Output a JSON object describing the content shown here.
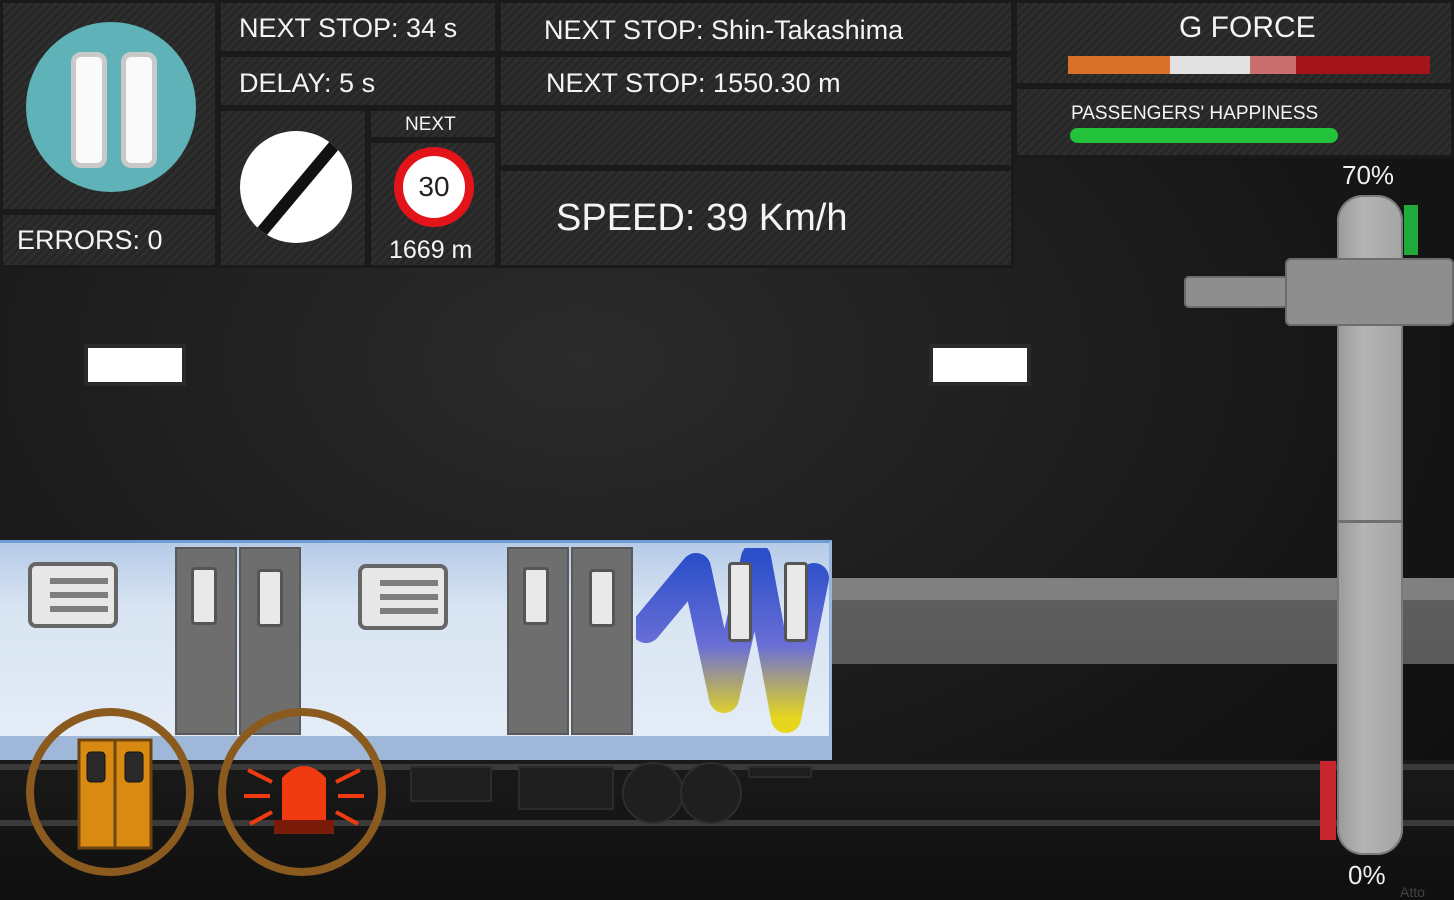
{
  "hud": {
    "errors": "ERRORS: 0",
    "next_stop_time": "NEXT STOP: 34 s",
    "delay": "DELAY: 5 s",
    "next_stop_name": "NEXT STOP: Shin-Takashima",
    "next_stop_distance": "NEXT STOP: 1550.30 m",
    "speed": "SPEED: 39 Km/h",
    "next_sign_label": "NEXT",
    "next_speed_limit": "30",
    "next_sign_distance": "1669 m",
    "gforce_title": "G FORCE",
    "happiness_title": "PASSENGERS' HAPPINESS"
  },
  "gforce_segments": [
    {
      "color": "#d8722a"
    },
    {
      "color": "#e2e2e2"
    },
    {
      "color": "#c96f6f"
    },
    {
      "color": "#a3141b"
    }
  ],
  "happiness_level": 1.0,
  "throttle": {
    "max_label": "70%",
    "min_label": "0%",
    "throttle_level": 0.1,
    "brake_level": 0.12
  },
  "colors": {
    "pause_button": "#5fb3b8",
    "happiness": "#22c23a",
    "alarm": "#f03a10",
    "door_button": "#d98a12",
    "ring": "#8a5a1e"
  },
  "icons": {
    "pause": "pause-icon",
    "end_limit": "end-of-speed-limit-icon",
    "doors": "doors-icon",
    "alarm": "alarm-beacon-icon"
  },
  "watermark": "Atto"
}
